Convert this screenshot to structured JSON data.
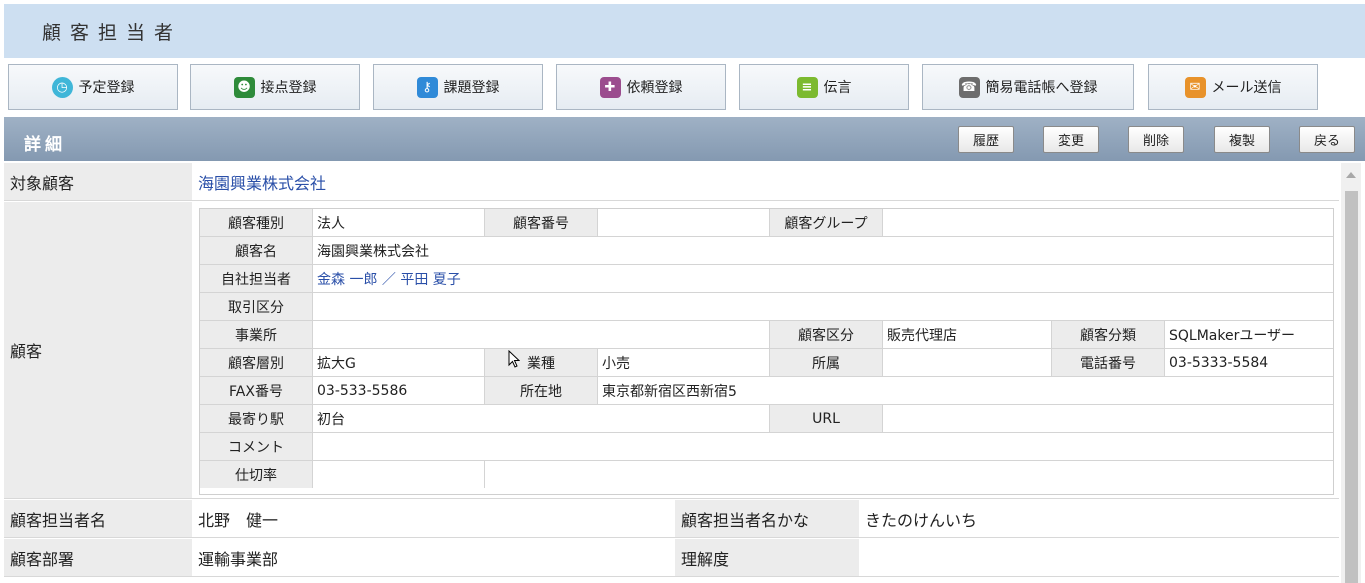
{
  "header": {
    "title": "顧客担当者"
  },
  "toolbar": {
    "buttons": [
      {
        "label": "予定登録",
        "icon": "clock-icon",
        "color": "#3fb6d8"
      },
      {
        "label": "接点登録",
        "icon": "people-icon",
        "color": "#2e8b3a"
      },
      {
        "label": "課題登録",
        "icon": "key-icon",
        "color": "#2f8ad8"
      },
      {
        "label": "依頼登録",
        "icon": "gift-icon",
        "color": "#9b4d8e"
      },
      {
        "label": "伝言",
        "icon": "memo-icon",
        "color": "#7cba2f"
      },
      {
        "label": "簡易電話帳へ登録",
        "icon": "phone-icon",
        "color": "#6d6d6d"
      },
      {
        "label": "メール送信",
        "icon": "mail-icon",
        "color": "#e8922a"
      }
    ]
  },
  "detail": {
    "title": "詳細",
    "buttons": [
      "履歴",
      "変更",
      "削除",
      "複製",
      "戻る"
    ]
  },
  "fields": {
    "target_customer_label": "対象顧客",
    "target_customer_value": "海園興業株式会社",
    "customer_label": "顧客",
    "contact_name_label": "顧客担当者名",
    "contact_name_value": "北野　健一",
    "contact_kana_label": "顧客担当者名かな",
    "contact_kana_value": "きたのけんいち",
    "department_label": "顧客部署",
    "department_value": "運輸事業部",
    "understanding_label": "理解度",
    "understanding_value": ""
  },
  "customer": {
    "type_label": "顧客種別",
    "type_value": "法人",
    "number_label": "顧客番号",
    "number_value": "",
    "group_label": "顧客グループ",
    "group_value": "",
    "name_label": "顧客名",
    "name_value": "海園興業株式会社",
    "owner_label": "自社担当者",
    "owner_value": "金森 一郎 ／ 平田 夏子",
    "trade_label": "取引区分",
    "trade_value": "",
    "office_label": "事業所",
    "office_value": "",
    "category_label": "顧客区分",
    "category_value": "販売代理店",
    "class_label": "顧客分類",
    "class_value": "SQLMakerユーザー",
    "tier_label": "顧客層別",
    "tier_value": "拡大G",
    "industry_label": "業種",
    "industry_value": "小売",
    "affiliation_label": "所属",
    "affiliation_value": "",
    "phone_label": "電話番号",
    "phone_value": "03-5333-5584",
    "fax_label": "FAX番号",
    "fax_value": "03-533-5586",
    "address_label": "所在地",
    "address_value": "東京都新宿区西新宿5",
    "station_label": "最寄り駅",
    "station_value": "初台",
    "url_label": "URL",
    "url_value": "",
    "comment_label": "コメント",
    "comment_value": "",
    "rate_label": "仕切率",
    "rate_value": ""
  }
}
